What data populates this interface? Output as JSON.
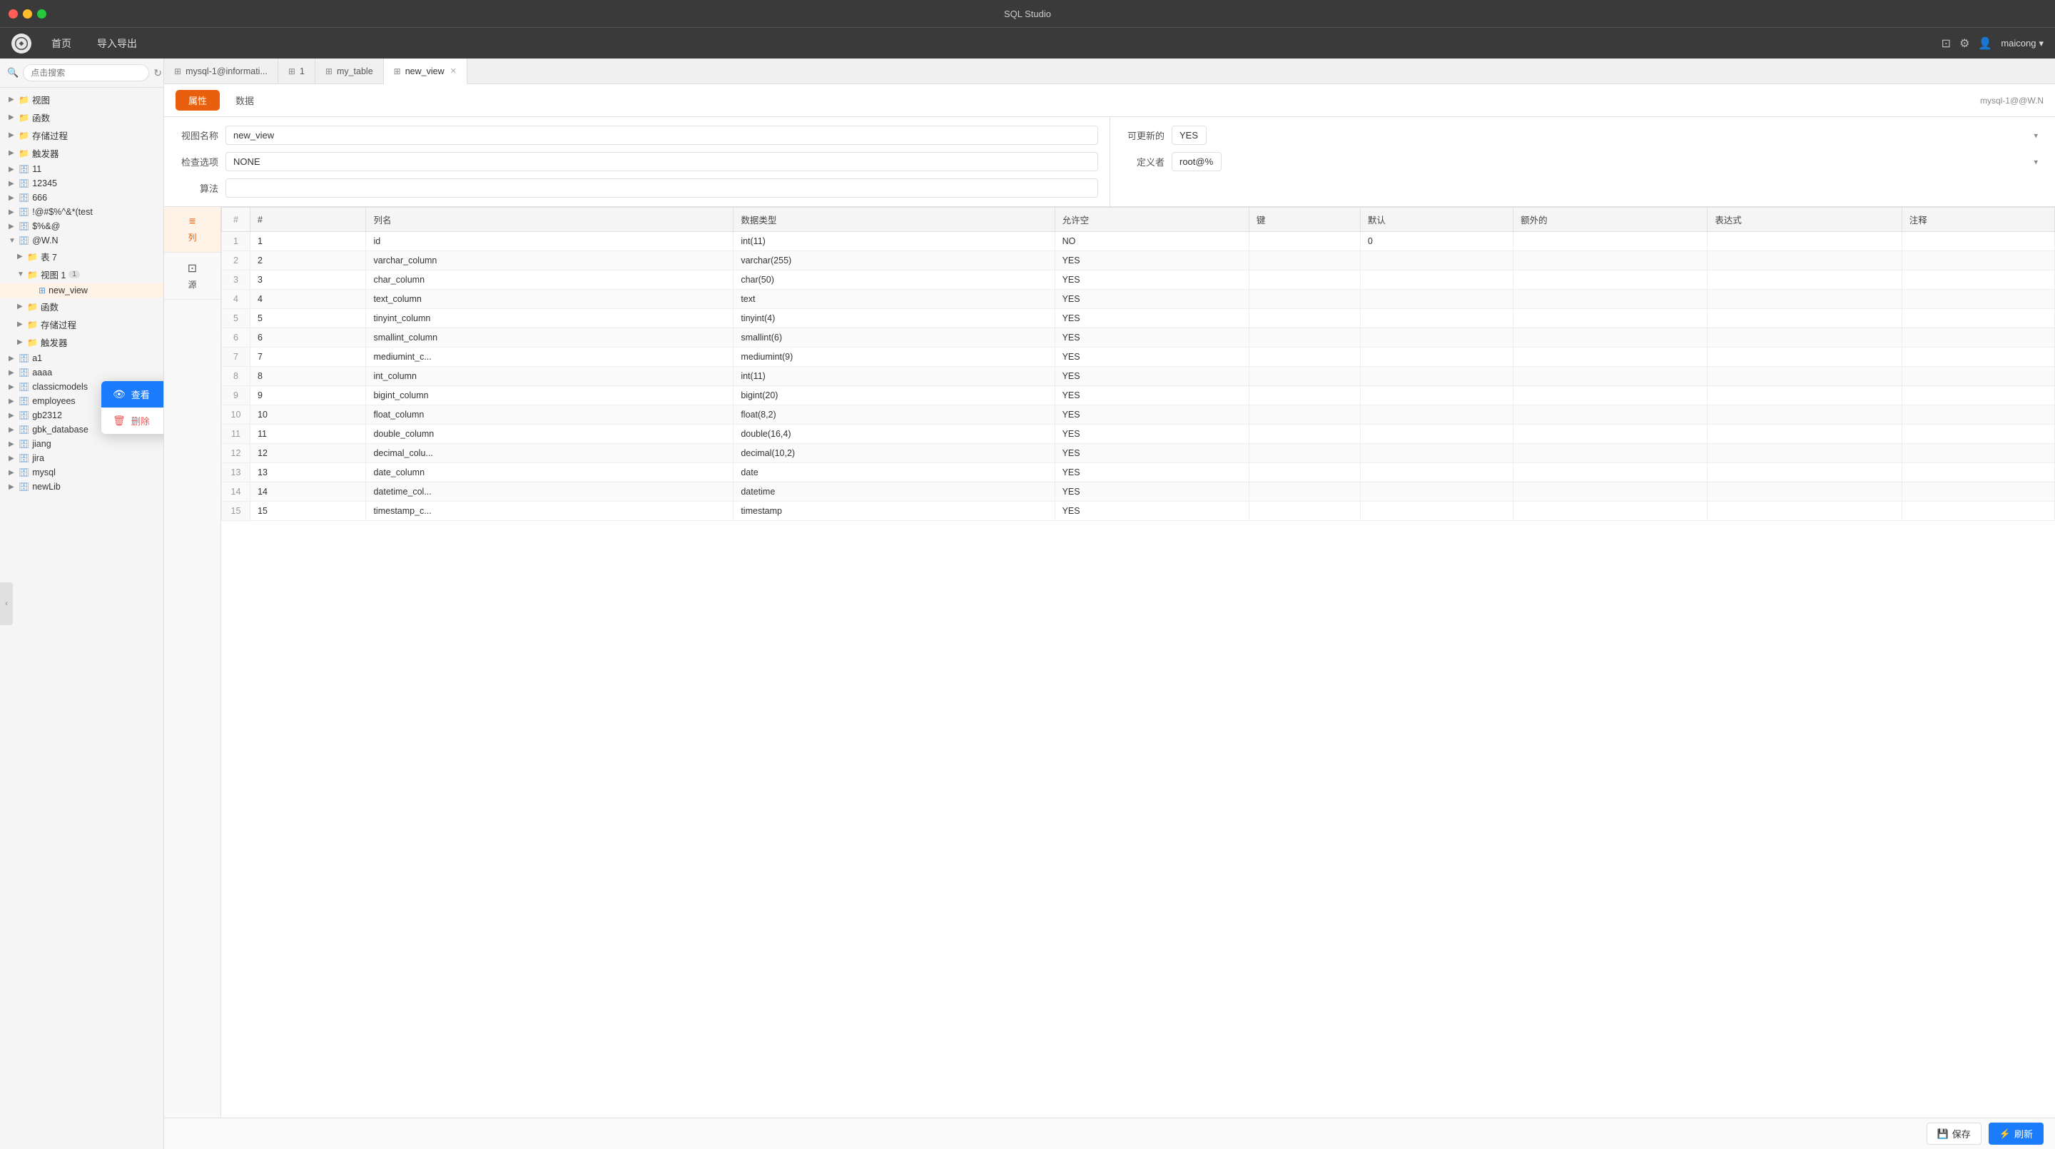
{
  "app": {
    "title": "SQL Studio"
  },
  "topnav": {
    "items": [
      "首页",
      "导入导出"
    ],
    "user": "maicong",
    "user_arrow": "▾",
    "server": "mysql-1@@W.N"
  },
  "sidebar": {
    "search_placeholder": "点击搜索",
    "tree": [
      {
        "id": "视图",
        "label": "视图",
        "level": 0,
        "type": "folder",
        "arrow": "▶"
      },
      {
        "id": "函数",
        "label": "函数",
        "level": 0,
        "type": "folder",
        "arrow": "▶"
      },
      {
        "id": "存储过程",
        "label": "存储过程",
        "level": 0,
        "type": "folder",
        "arrow": "▶"
      },
      {
        "id": "触发器",
        "label": "触发器",
        "level": 0,
        "type": "folder",
        "arrow": "▶"
      },
      {
        "id": "11",
        "label": "11",
        "level": 0,
        "type": "db",
        "arrow": "▶"
      },
      {
        "id": "12345",
        "label": "12345",
        "level": 0,
        "type": "db",
        "arrow": "▶"
      },
      {
        "id": "666",
        "label": "666",
        "level": 0,
        "type": "db",
        "arrow": "▶"
      },
      {
        "id": "!@#$%^&*(test",
        "label": "!@#$%^&*(test",
        "level": 0,
        "type": "db",
        "arrow": "▶"
      },
      {
        "id": "$%&@",
        "label": "$%&@",
        "level": 0,
        "type": "db",
        "arrow": "▶"
      },
      {
        "id": "@W.N",
        "label": "@W.N",
        "level": 0,
        "type": "db",
        "arrow": "▼",
        "expanded": true
      },
      {
        "id": "表7",
        "label": "表 7",
        "level": 1,
        "type": "folder",
        "arrow": "▶"
      },
      {
        "id": "视图1",
        "label": "视图 1",
        "level": 1,
        "type": "folder",
        "arrow": "▼",
        "expanded": true,
        "badge": "1"
      },
      {
        "id": "new_view",
        "label": "new_view",
        "level": 2,
        "type": "view",
        "active": true
      },
      {
        "id": "函数2",
        "label": "函数",
        "level": 1,
        "type": "folder",
        "arrow": "▶"
      },
      {
        "id": "存储过程2",
        "label": "存储过程",
        "level": 1,
        "type": "folder",
        "arrow": "▶"
      },
      {
        "id": "触发器2",
        "label": "触发器",
        "level": 1,
        "type": "folder",
        "arrow": "▶"
      },
      {
        "id": "a1",
        "label": "a1",
        "level": 0,
        "type": "db",
        "arrow": "▶"
      },
      {
        "id": "aaaa",
        "label": "aaaa",
        "level": 0,
        "type": "db",
        "arrow": "▶"
      },
      {
        "id": "classicmodels",
        "label": "classicmodels",
        "level": 0,
        "type": "db",
        "arrow": "▶"
      },
      {
        "id": "employees",
        "label": "employees",
        "level": 0,
        "type": "db",
        "arrow": "▶"
      },
      {
        "id": "gb2312",
        "label": "gb2312",
        "level": 0,
        "type": "db",
        "arrow": "▶"
      },
      {
        "id": "gbk_database",
        "label": "gbk_database",
        "level": 0,
        "type": "db",
        "arrow": "▶"
      },
      {
        "id": "jiang",
        "label": "jiang",
        "level": 0,
        "type": "db",
        "arrow": "▶"
      },
      {
        "id": "jira",
        "label": "jira",
        "level": 0,
        "type": "db",
        "arrow": "▶"
      },
      {
        "id": "mysql",
        "label": "mysql",
        "level": 0,
        "type": "db",
        "arrow": "▶"
      },
      {
        "id": "newLib",
        "label": "newLib",
        "level": 0,
        "type": "db",
        "arrow": "▶"
      }
    ]
  },
  "context_menu": {
    "items": [
      {
        "id": "view",
        "label": "查看",
        "icon": "👁",
        "type": "highlight"
      },
      {
        "id": "delete",
        "label": "删除",
        "icon": "🗑",
        "type": "danger"
      }
    ]
  },
  "tabs": [
    {
      "id": "mysql-1",
      "label": "mysql-1@informati...",
      "icon": "⊞",
      "closeable": false
    },
    {
      "id": "1",
      "label": "1",
      "icon": "⊞",
      "closeable": false
    },
    {
      "id": "my_table",
      "label": "my_table",
      "icon": "⊞",
      "closeable": false
    },
    {
      "id": "new_view",
      "label": "new_view",
      "icon": "⊞",
      "closeable": true,
      "active": true
    }
  ],
  "view_toolbar": {
    "tabs": [
      {
        "id": "attr",
        "label": "属性",
        "active": true
      },
      {
        "id": "data",
        "label": "数据",
        "active": false
      }
    ],
    "server_label": "mysql-1@@W.N"
  },
  "form": {
    "left": [
      {
        "label": "视图名称",
        "value": "new_view",
        "type": "input"
      },
      {
        "label": "检查选项",
        "value": "NONE",
        "type": "input"
      },
      {
        "label": "算法",
        "value": "",
        "type": "input"
      }
    ],
    "right": [
      {
        "label": "可更新的",
        "value": "YES",
        "type": "select"
      },
      {
        "label": "定义者",
        "value": "root@%",
        "type": "select"
      }
    ]
  },
  "table_sidebar": [
    {
      "id": "list",
      "label": "列",
      "icon": "≡",
      "active": true
    },
    {
      "id": "source",
      "label": "源",
      "icon": "⊡",
      "active": false
    }
  ],
  "table": {
    "headers": [
      "#",
      "列名",
      "数据类型",
      "允许空",
      "键",
      "默认",
      "额外的",
      "表达式",
      "注释"
    ],
    "rows": [
      {
        "row_num": "1",
        "num": "1",
        "col_name": "id",
        "data_type": "int(11)",
        "nullable": "NO",
        "key": "",
        "default_val": "0",
        "extra": "",
        "expression": "",
        "comment": ""
      },
      {
        "row_num": "2",
        "num": "2",
        "col_name": "varchar_column",
        "data_type": "varchar(255)",
        "nullable": "YES",
        "key": "",
        "default_val": "",
        "extra": "",
        "expression": "",
        "comment": ""
      },
      {
        "row_num": "3",
        "num": "3",
        "col_name": "char_column",
        "data_type": "char(50)",
        "nullable": "YES",
        "key": "",
        "default_val": "",
        "extra": "",
        "expression": "",
        "comment": ""
      },
      {
        "row_num": "4",
        "num": "4",
        "col_name": "text_column",
        "data_type": "text",
        "nullable": "YES",
        "key": "",
        "default_val": "",
        "extra": "",
        "expression": "",
        "comment": ""
      },
      {
        "row_num": "5",
        "num": "5",
        "col_name": "tinyint_column",
        "data_type": "tinyint(4)",
        "nullable": "YES",
        "key": "",
        "default_val": "",
        "extra": "",
        "expression": "",
        "comment": ""
      },
      {
        "row_num": "6",
        "num": "6",
        "col_name": "smallint_column",
        "data_type": "smallint(6)",
        "nullable": "YES",
        "key": "",
        "default_val": "",
        "extra": "",
        "expression": "",
        "comment": ""
      },
      {
        "row_num": "7",
        "num": "7",
        "col_name": "mediumint_c...",
        "data_type": "mediumint(9)",
        "nullable": "YES",
        "key": "",
        "default_val": "",
        "extra": "",
        "expression": "",
        "comment": ""
      },
      {
        "row_num": "8",
        "num": "8",
        "col_name": "int_column",
        "data_type": "int(11)",
        "nullable": "YES",
        "key": "",
        "default_val": "",
        "extra": "",
        "expression": "",
        "comment": ""
      },
      {
        "row_num": "9",
        "num": "9",
        "col_name": "bigint_column",
        "data_type": "bigint(20)",
        "nullable": "YES",
        "key": "",
        "default_val": "",
        "extra": "",
        "expression": "",
        "comment": ""
      },
      {
        "row_num": "10",
        "num": "10",
        "col_name": "float_column",
        "data_type": "float(8,2)",
        "nullable": "YES",
        "key": "",
        "default_val": "",
        "extra": "",
        "expression": "",
        "comment": ""
      },
      {
        "row_num": "11",
        "num": "11",
        "col_name": "double_column",
        "data_type": "double(16,4)",
        "nullable": "YES",
        "key": "",
        "default_val": "",
        "extra": "",
        "expression": "",
        "comment": ""
      },
      {
        "row_num": "12",
        "num": "12",
        "col_name": "decimal_colu...",
        "data_type": "decimal(10,2)",
        "nullable": "YES",
        "key": "",
        "default_val": "",
        "extra": "",
        "expression": "",
        "comment": ""
      },
      {
        "row_num": "13",
        "num": "13",
        "col_name": "date_column",
        "data_type": "date",
        "nullable": "YES",
        "key": "",
        "default_val": "",
        "extra": "",
        "expression": "",
        "comment": ""
      },
      {
        "row_num": "14",
        "num": "14",
        "col_name": "datetime_col...",
        "data_type": "datetime",
        "nullable": "YES",
        "key": "",
        "default_val": "",
        "extra": "",
        "expression": "",
        "comment": ""
      },
      {
        "row_num": "15",
        "num": "15",
        "col_name": "timestamp_c...",
        "data_type": "timestamp",
        "nullable": "YES",
        "key": "",
        "default_val": "",
        "extra": "",
        "expression": "",
        "comment": ""
      }
    ]
  },
  "bottom_bar": {
    "save_label": "保存",
    "refresh_label": "刷新"
  }
}
